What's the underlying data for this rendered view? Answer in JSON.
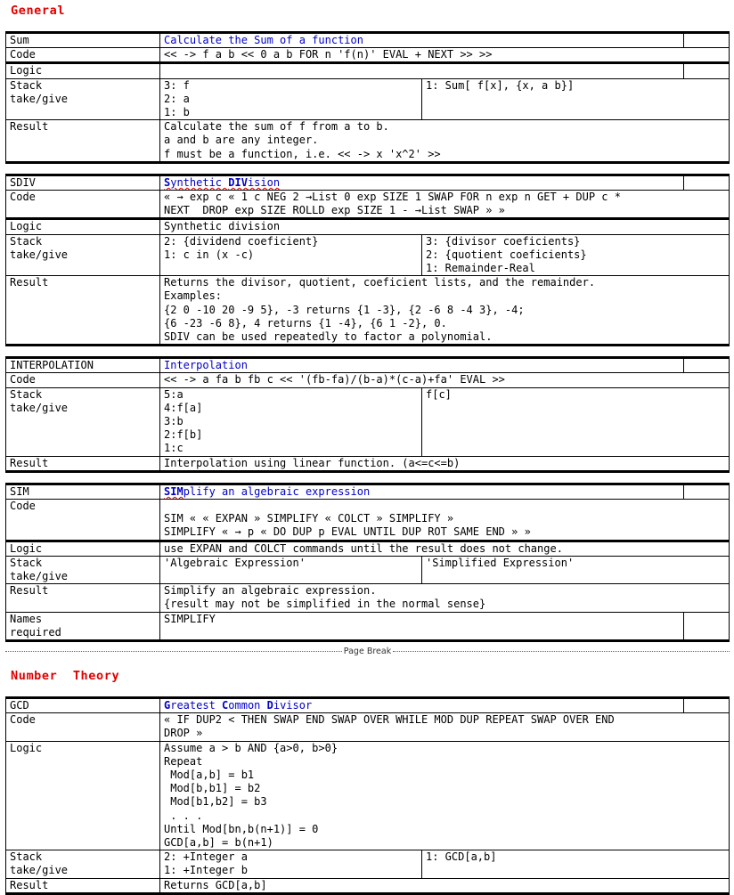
{
  "document": {
    "sections": [
      {
        "heading": "General",
        "heading_color": "#e00000",
        "tables": [
          {
            "name_label": "Sum",
            "title_prefix": "",
            "title": "Calculate the Sum of a function",
            "title_color": "#0000c8",
            "rows": {
              "code_label": "Code",
              "code": "<< -> f a b << 0 a b FOR n 'f(n)' EVAL + NEXT >> >>",
              "logic_label": "Logic",
              "logic": "",
              "stack_label": "Stack\ntake/give",
              "stack_take": "3: f\n2: a\n1: b",
              "stack_give": "1: Sum[ f[x], {x, a b}]",
              "result_label": "Result",
              "result": "Calculate the sum of f from a to b.\na and b are any integer.\nf must be a function, i.e. << -> x 'x^2' >>"
            }
          },
          {
            "name_label": "SDIV",
            "title_bold_1": "S",
            "title_rest_1": "ynthetic ",
            "title_bold_2": "DIV",
            "title_rest_2": "ision",
            "title": "Synthetic DIVision",
            "title_color": "#0000c8",
            "rows": {
              "code_label": "Code",
              "code": "« → exp c « 1 c NEG 2 →List 0 exp SIZE 1 SWAP FOR n exp n GET + DUP c *\nNEXT  DROP exp SIZE ROLLD exp SIZE 1 - →List SWAP » »",
              "logic_label": "Logic",
              "logic": "Synthetic division",
              "stack_label": "Stack\ntake/give",
              "stack_take": "2: {dividend coeficient}\n1: c in (x -c)",
              "stack_give": "3: {divisor coeficients}\n2: {quotient coeficients}\n1: Remainder-Real",
              "result_label": "Result",
              "result": "Returns the divisor, quotient, coeficient lists, and the remainder.\nExamples:\n{2 0 -10 20 -9 5}, -3 returns {1 -3}, {2 -6 8 -4 3}, -4;\n{6 -23 -6 8}, 4 returns {1 -4}, {6 1 -2}, 0.\nSDIV can be used repeatedly to factor a polynomial."
            }
          },
          {
            "name_label": "INTERPOLATION",
            "title": "Interpolation",
            "title_color": "#0000c8",
            "rows": {
              "code_label": "Code",
              "code": "<< -> a fa b fb c << '(fb-fa)/(b-a)*(c-a)+fa' EVAL >>",
              "stack_label": "Stack\ntake/give",
              "stack_take": "5:a\n4:f[a]\n3:b\n2:f[b]\n1:c",
              "stack_give": "f[c]",
              "result_label": "Result",
              "result": "Interpolation using linear function. (a<=c<=b)"
            }
          },
          {
            "name_label": "SIM",
            "title_bold_1": "SIM",
            "title_rest_1": "plify an algebraic expression",
            "title": "SIMplify an algebraic expression",
            "title_color": "#0000c8",
            "rows": {
              "code_label": "Code",
              "code": "SIM « « EXPAN » SIMPLIFY « COLCT » SIMPLIFY »\nSIMPLIFY « → p « DO DUP p EVAL UNTIL DUP ROT SAME END » »",
              "logic_label": "Logic",
              "logic": "use EXPAN and COLCT commands until the result does not change.",
              "stack_label": "Stack\ntake/give",
              "stack_take": "'Algebraic Expression'",
              "stack_give": "'Simplified Expression'",
              "result_label": "Result",
              "result": "Simplify an algebraic expression.\n{result may not be simplified in the normal sense}",
              "names_label": "Names\nrequired",
              "names": "SIMPLIFY"
            }
          }
        ]
      },
      {
        "page_break_label": "Page Break",
        "heading": "Number  Theory",
        "heading_color": "#e00000",
        "tables": [
          {
            "name_label": "GCD",
            "title_bold_1": "G",
            "title_rest_1": "reatest ",
            "title_bold_2": "C",
            "title_rest_2": "ommon ",
            "title_bold_3": "D",
            "title_rest_3": "ivisor",
            "title": "Greatest Common Divisor",
            "title_color": "#0000c8",
            "rows": {
              "code_label": "Code",
              "code": "« IF DUP2 < THEN SWAP END SWAP OVER WHILE MOD DUP REPEAT SWAP OVER END\nDROP »",
              "logic_label": "Logic",
              "logic": "Assume a > b AND {a>0, b>0}\nRepeat\n Mod[a,b] = b1\n Mod[b,b1] = b2\n Mod[b1,b2] = b3\n . . .\nUntil Mod[bn,b(n+1)] = 0\nGCD[a,b] = b(n+1)",
              "stack_label": "Stack\ntake/give",
              "stack_take": "2: +Integer a\n1: +Integer b",
              "stack_give": "1: GCD[a,b]",
              "result_label": "Result",
              "result": "Returns GCD[a,b]"
            }
          }
        ]
      }
    ]
  }
}
